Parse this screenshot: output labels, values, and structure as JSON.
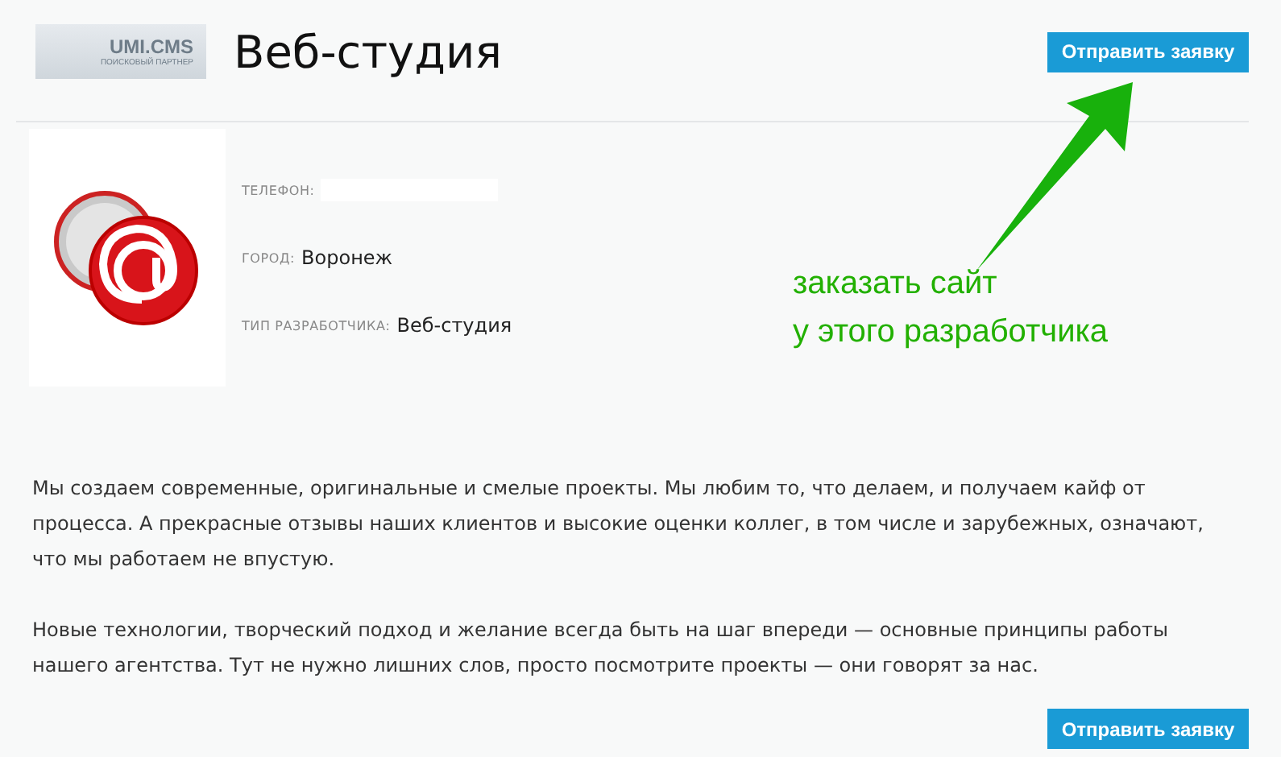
{
  "logo": {
    "name": "UMI.CMS",
    "caption": "ПОИСКОВЫЙ ПАРТНЕР"
  },
  "title": "Веб-студия",
  "top_button": "Отправить заявку",
  "fields": [
    {
      "label": "ТЕЛЕФОН:",
      "kind": "hidden"
    },
    {
      "label": "ГОРОД:",
      "kind": "text",
      "value": "Воронеж"
    },
    {
      "label": "ТИП РАЗРАБОТЧИКА:",
      "kind": "text",
      "value": "Веб-студия"
    }
  ],
  "annotation": [
    "заказать сайт",
    "у этого разработчика"
  ],
  "paragraphs": [
    "Мы создаем современные, оригинальные и смелые проекты. Мы любим то, что делаем, и получаем кайф от процесса. А прекрасные отзывы наших клиентов и высокие оценки коллег, в том числе и зарубежных, означают, что мы работаем не впустую.",
    "Новые технологии, творческий подход и желание всегда быть на шаг впереди — основные принципы работы нашего агентства. Тут не нужно лишних слов, просто посмотрите проекты — они говорят за нас."
  ],
  "bottom_button": "Отправить заявку"
}
